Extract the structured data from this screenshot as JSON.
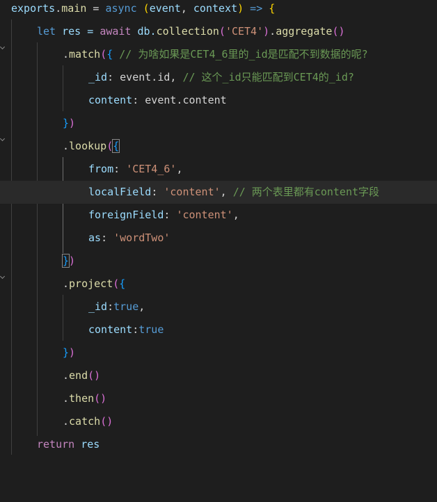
{
  "lines": {
    "l1": {
      "exports": "exports",
      "dot": ".",
      "main": "main",
      "eq": " = ",
      "async": "async",
      "sp": " ",
      "lp": "(",
      "event": "event",
      "comma": ", ",
      "context": "context",
      "rp": ")",
      "arrow": " => ",
      "lb": "{"
    },
    "l2": {
      "let": "let",
      "res": " res = ",
      "await": "await",
      "db": " db.",
      "collection": "collection",
      "lp": "(",
      "arg": "'CET4'",
      "rp": ")",
      "dot": ".",
      "aggregate": "aggregate",
      "parens": "()"
    },
    "l3": {
      "dot": ".",
      "match": "match",
      "lp": "(",
      "lb": "{",
      "comment": " // 为啥如果是CET4_6里的_id是匹配不到数据的呢?"
    },
    "l4": {
      "key": "_id",
      "colon": ": event.id, ",
      "comment": "// 这个_id只能匹配到CET4的_id?"
    },
    "l5": {
      "key": "content",
      "rest": ": event.content"
    },
    "l6": {
      "rb": "}",
      "rp": ")"
    },
    "l7": {
      "dot": ".",
      "lookup": "lookup",
      "lp": "(",
      "lb": "{"
    },
    "l8": {
      "key": "from",
      "colon": ": ",
      "val": "'CET4_6'",
      "comma": ","
    },
    "l9": {
      "key": "localField",
      "colon": ": ",
      "val": "'content'",
      "comma": ", ",
      "comment": "// 两个表里都有content字段"
    },
    "l10": {
      "key": "foreignField",
      "colon": ": ",
      "val": "'content'",
      "comma": ","
    },
    "l11": {
      "key": "as",
      "colon": ": ",
      "val": "'wordTwo'"
    },
    "l12": {
      "rb": "}",
      "rp": ")"
    },
    "l13": {
      "dot": ".",
      "project": "project",
      "lp": "(",
      "lb": "{"
    },
    "l14": {
      "key": "_id",
      "colon": ":",
      "val": "true",
      "comma": ","
    },
    "l15": {
      "key": "content",
      "colon": ":",
      "val": "true"
    },
    "l16": {
      "rb": "}",
      "rp": ")"
    },
    "l17": {
      "dot": ".",
      "end": "end",
      "parens": "()"
    },
    "l18": {
      "dot": ".",
      "then": "then",
      "parens": "()"
    },
    "l19": {
      "dot": ".",
      "catch": "catch",
      "parens": "()"
    },
    "l20": {
      "return": "return",
      "res": " res"
    }
  },
  "colors": {
    "background": "#1e1e1e",
    "current_line": "#2a2a2a",
    "keyword": "#569cd6",
    "control": "#c586c0",
    "variable": "#9cdcfe",
    "function": "#dcdcaa",
    "string": "#ce9178",
    "comment": "#6a9955",
    "bracket_1": "#ffd700",
    "bracket_2": "#da70d6",
    "bracket_3": "#179fff"
  },
  "icons": [
    "fold-chevron-icon"
  ]
}
